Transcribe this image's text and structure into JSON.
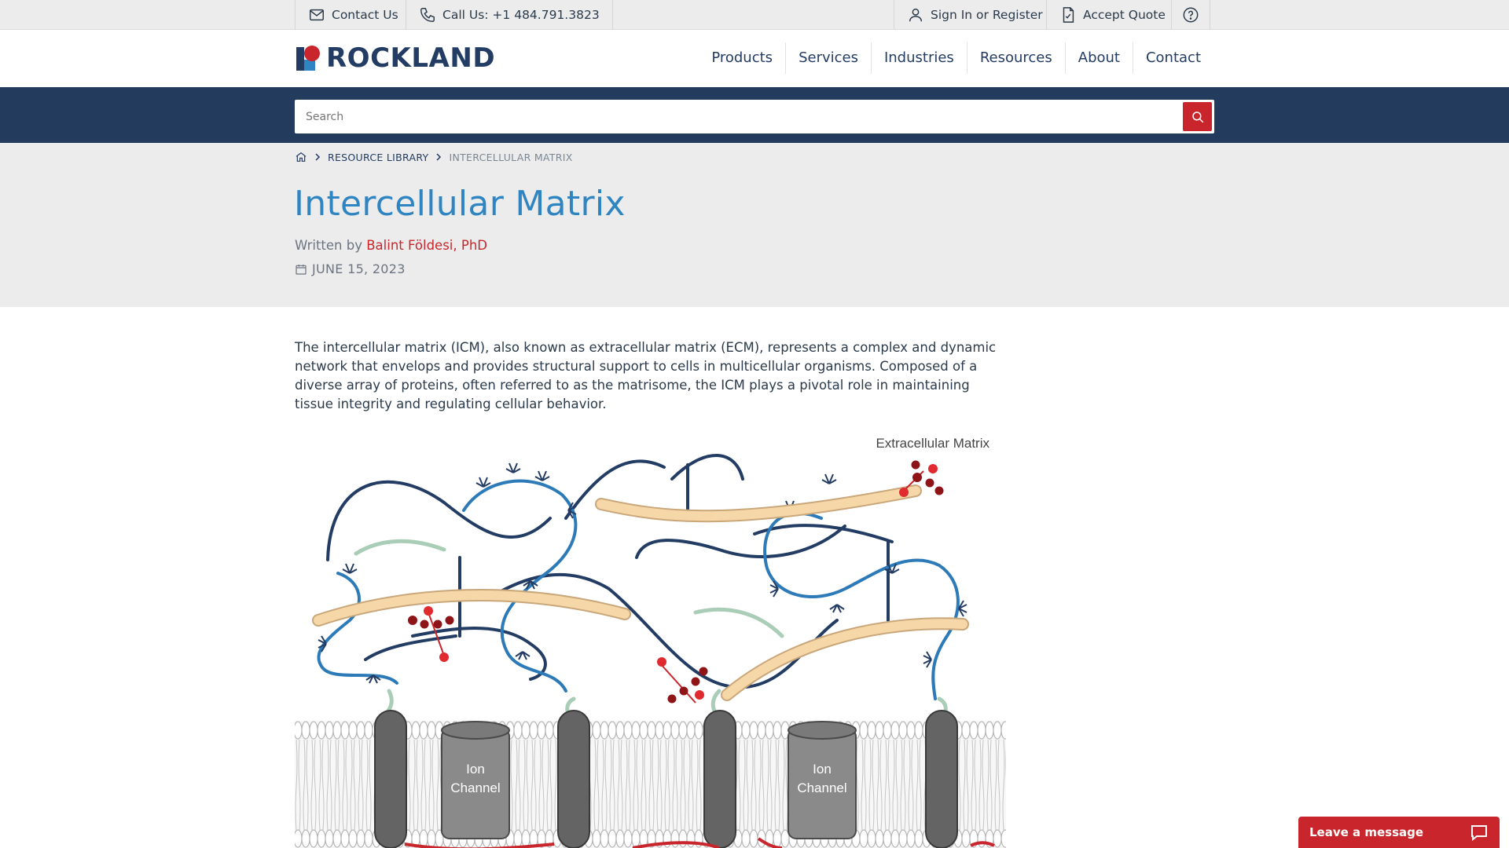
{
  "topbar": {
    "contact": "Contact Us",
    "call": "Call Us: +1 484.791.3823",
    "signin": "Sign In or Register",
    "quote": "Accept Quote"
  },
  "brand": {
    "name": "ROCKLAND",
    "color": "#233c63",
    "accent": "#c8262c"
  },
  "nav": [
    "Products",
    "Services",
    "Industries",
    "Resources",
    "About",
    "Contact"
  ],
  "search": {
    "placeholder": "Search"
  },
  "breadcrumb": {
    "level1": "RESOURCE LIBRARY",
    "current": "INTERCELLULAR MATRIX"
  },
  "article": {
    "title": "Intercellular Matrix",
    "written_by": "Written by",
    "author": "Balint Földesi, PhD",
    "date": "JUNE 15, 2023",
    "intro": "The intercellular matrix (ICM), also known as extracellular matrix (ECM), represents a complex and dynamic network that envelops and provides structural support to cells in multicellular organisms. Composed of a diverse array of proteins, often referred to as the matrisome, the ICM plays a pivotal role in maintaining tissue integrity and regulating cellular behavior."
  },
  "figure": {
    "label": "Extracellular Matrix",
    "ion_channel_1": "Ion",
    "ion_channel_2": "Channel"
  },
  "chat": {
    "label": "Leave a message"
  },
  "colors": {
    "title_blue": "#2f84c2",
    "navy_band": "#233c5e",
    "hero_gray": "#ececec"
  }
}
